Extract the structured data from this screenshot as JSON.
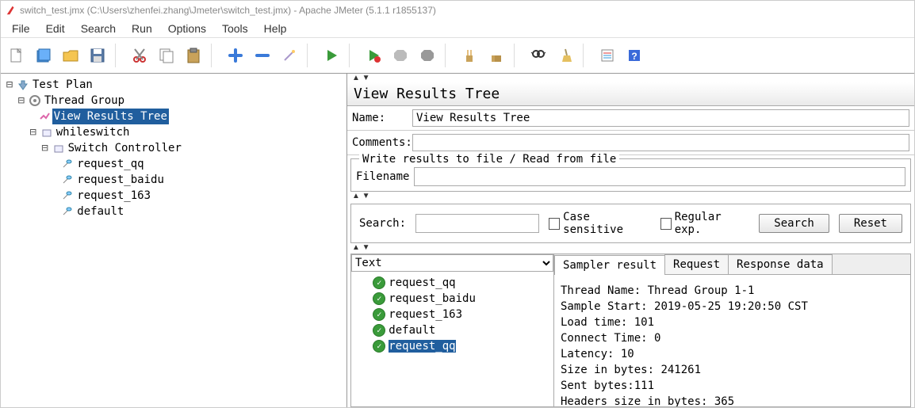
{
  "window_title": "switch_test.jmx (C:\\Users\\zhenfei.zhang\\Jmeter\\switch_test.jmx) - Apache JMeter (5.1.1 r1855137)",
  "menus": [
    "File",
    "Edit",
    "Search",
    "Run",
    "Options",
    "Tools",
    "Help"
  ],
  "toolbar_icons": [
    "new",
    "templates",
    "open",
    "save",
    "cut",
    "copy",
    "paste",
    "add",
    "remove",
    "wand",
    "start",
    "start-no-timers",
    "stop",
    "shutdown",
    "clear",
    "clear-all",
    "find",
    "broom",
    "props-icon",
    "help-icon"
  ],
  "tree": {
    "root": "Test Plan",
    "thread_group": "Thread Group",
    "view_results": "View Results Tree",
    "whileswitch": "whileswitch",
    "switch_controller": "Switch Controller",
    "samplers": [
      "request_qq",
      "request_baidu",
      "request_163",
      "default"
    ]
  },
  "panel_title": "View Results Tree",
  "name_label": "Name:",
  "name_value": "View Results Tree",
  "comments_label": "Comments:",
  "groupbox_legend": "Write results to file / Read from file",
  "filename_label": "Filename",
  "search_label": "Search:",
  "case_sensitive": "Case sensitive",
  "regular_exp": "Regular exp.",
  "search_btn": "Search",
  "reset_btn": "Reset",
  "renderer": "Text",
  "results": [
    "request_qq",
    "request_baidu",
    "request_163",
    "default",
    "request_qq"
  ],
  "selected_result_index": 4,
  "tabs": {
    "sampler": "Sampler result",
    "request": "Request",
    "response": "Response data"
  },
  "details": {
    "thread_name_label": "Thread Name: ",
    "thread_name": "Thread Group 1-1",
    "sample_start_label": "Sample Start: ",
    "sample_start": "2019-05-25 19:20:50 CST",
    "load_time_label": "Load time: ",
    "load_time": "101",
    "connect_time_label": "Connect Time: ",
    "connect_time": "0",
    "latency_label": "Latency: ",
    "latency": "10",
    "size_bytes_label": "Size in bytes: ",
    "size_bytes": "241261",
    "sent_bytes_label": "Sent bytes:",
    "sent_bytes": "111",
    "headers_size_label": "Headers size in bytes: ",
    "headers_size": "365"
  }
}
